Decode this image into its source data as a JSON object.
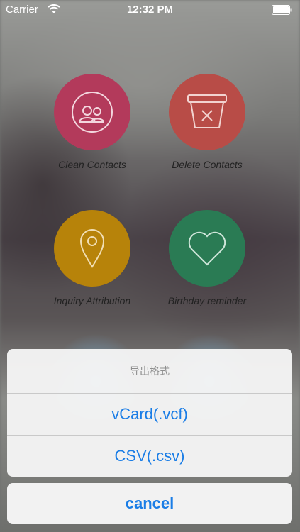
{
  "status_bar": {
    "carrier": "Carrier",
    "time": "12:32 PM"
  },
  "tiles": [
    {
      "label": "Clean Contacts",
      "icon": "contacts-icon",
      "color": "#b33a5b"
    },
    {
      "label": "Delete Contacts",
      "icon": "trash-basket-icon",
      "color": "#b84c47"
    },
    {
      "label": "Inquiry Attribution",
      "icon": "location-pin-icon",
      "color": "#b7830a"
    },
    {
      "label": "Birthday reminder",
      "icon": "heart-icon",
      "color": "#2a7b54"
    }
  ],
  "action_sheet": {
    "title": "导出格式",
    "options": [
      "vCard(.vcf)",
      "CSV(.csv)"
    ],
    "cancel": "cancel"
  },
  "colors": {
    "accent": "#1a7de6"
  }
}
